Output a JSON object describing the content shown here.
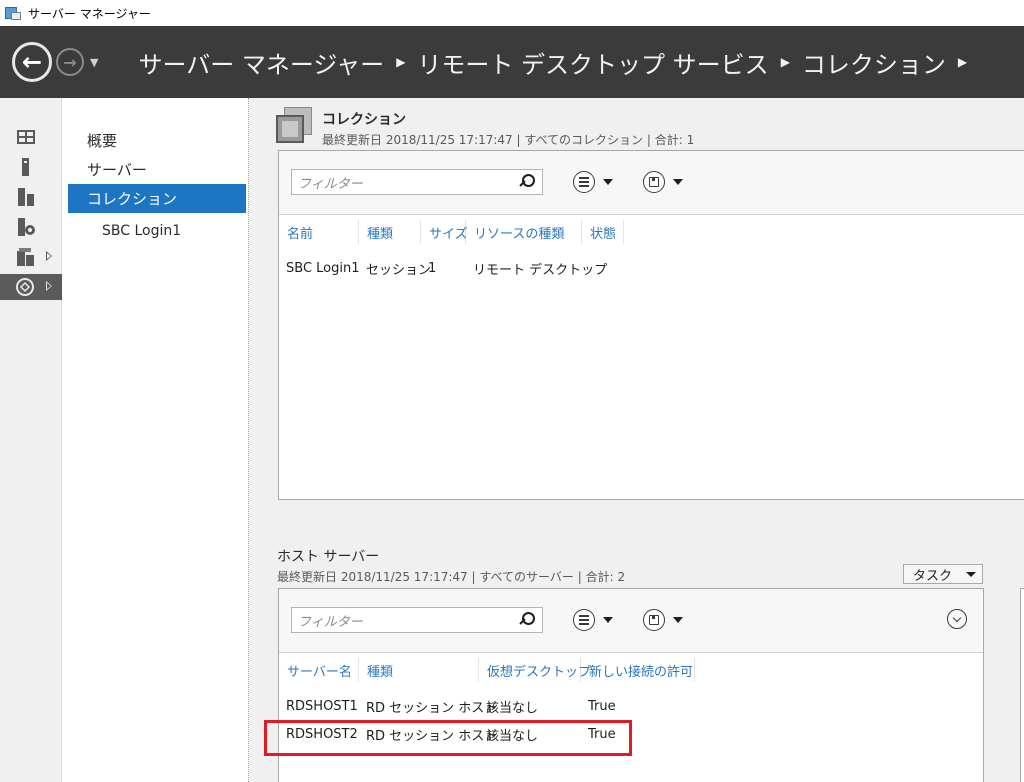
{
  "window": {
    "title": "サーバー マネージャー"
  },
  "header": {
    "breadcrumb": [
      "サーバー マネージャー",
      "リモート デスクトップ サービス",
      "コレクション"
    ]
  },
  "rail": {
    "icons": [
      "dashboard-icon",
      "local-server-icon",
      "all-servers-icon",
      "file-services-icon",
      "roles-icon",
      "remote-desktop-icon"
    ]
  },
  "nav": {
    "items": [
      {
        "label": "概要",
        "selected": false
      },
      {
        "label": "サーバー",
        "selected": false
      },
      {
        "label": "コレクション",
        "selected": true
      },
      {
        "label": "SBC Login1",
        "selected": false,
        "sub": true
      }
    ]
  },
  "collections": {
    "title": "コレクション",
    "meta": "最終更新日 2018/11/25 17:17:47 | すべてのコレクション | 合計: 1",
    "filter_placeholder": "フィルター",
    "columns": [
      "名前",
      "種類",
      "サイズ",
      "リソースの種類",
      "状態"
    ],
    "rows": [
      [
        "SBC Login1",
        "セッション",
        "1",
        "リモート デスクトップ",
        ""
      ]
    ]
  },
  "host_servers": {
    "title": "ホスト サーバー",
    "meta": "最終更新日 2018/11/25 17:17:47 | すべてのサーバー | 合計: 2",
    "task_label": "タスク",
    "filter_placeholder": "フィルター",
    "columns": [
      "サーバー名",
      "種類",
      "仮想デスクトップ",
      "新しい接続の許可"
    ],
    "rows": [
      [
        "RDSHOST1",
        "RD セッション ホスト",
        "該当なし",
        "True"
      ],
      [
        "RDSHOST2",
        "RD セッション ホスト",
        "該当なし",
        "True"
      ]
    ]
  },
  "colors": {
    "accent": "#1c76c4",
    "header": "#3b3b3b",
    "highlight": "#e01b24",
    "link": "#2b77c0"
  }
}
